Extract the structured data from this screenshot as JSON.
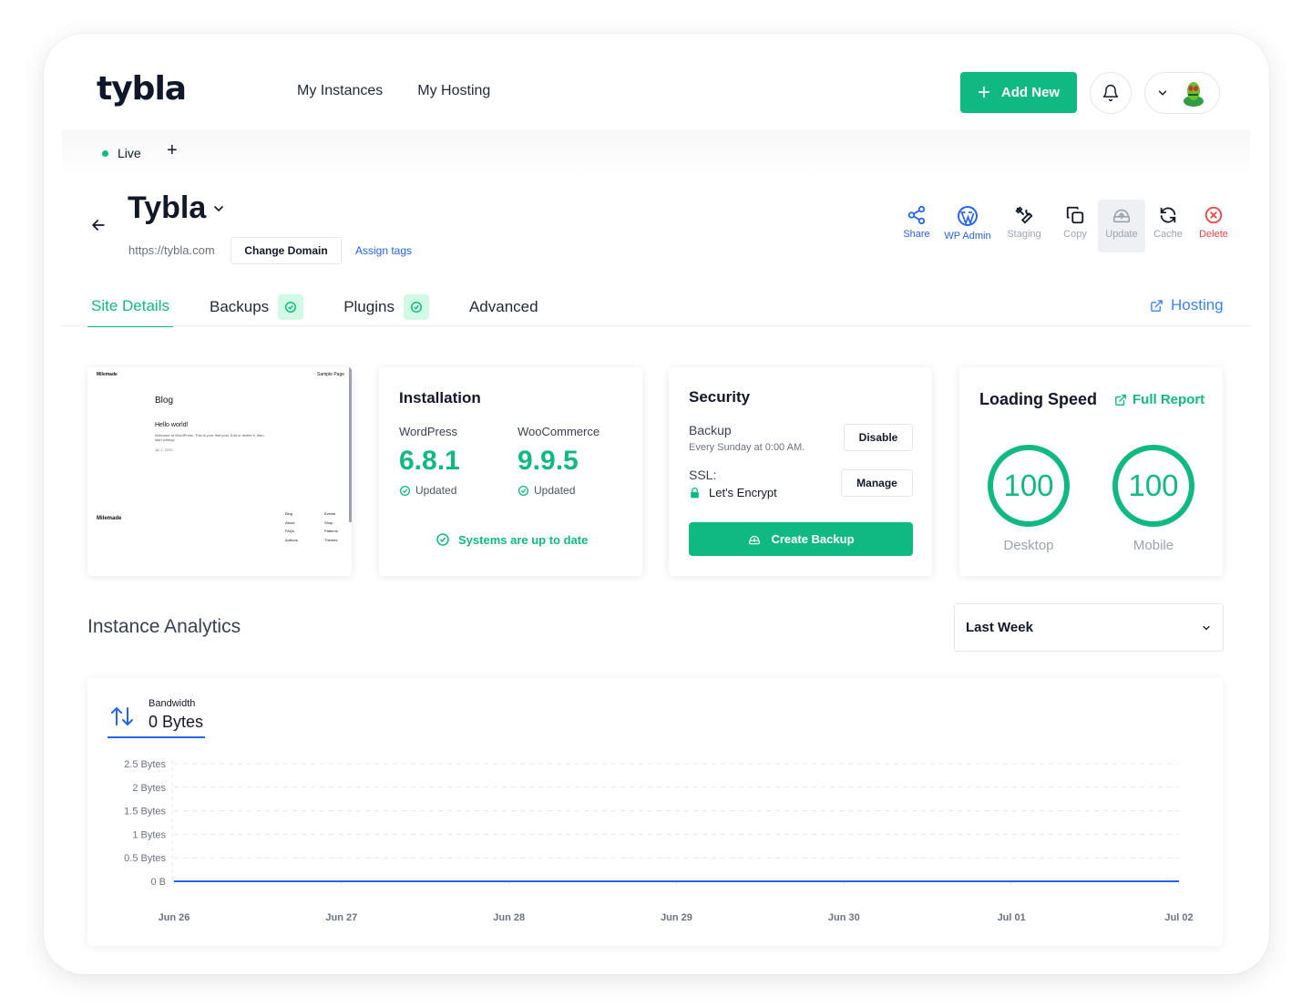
{
  "brand": {
    "logo": "tybla",
    "accent": "#10b981",
    "link": "#2563eb",
    "danger": "#ef4444"
  },
  "nav": {
    "items": [
      "My Instances",
      "My Hosting"
    ]
  },
  "header": {
    "add_new": "Add New"
  },
  "environment": {
    "live": "Live",
    "add": "+"
  },
  "site": {
    "title": "Tybla",
    "url": "https://tybla.com",
    "change_domain": "Change Domain",
    "assign_tags": "Assign tags"
  },
  "actions": [
    {
      "label": "Share",
      "icon": "share-icon"
    },
    {
      "label": "WP Admin",
      "icon": "wordpress-icon"
    },
    {
      "label": "Staging",
      "icon": "tools-icon"
    },
    {
      "label": "Copy",
      "icon": "copy-icon"
    },
    {
      "label": "Update",
      "icon": "update-icon"
    },
    {
      "label": "Cache",
      "icon": "refresh-icon"
    },
    {
      "label": "Delete",
      "icon": "delete-icon"
    }
  ],
  "tabs": [
    {
      "label": "Site Details",
      "active": true
    },
    {
      "label": "Backups",
      "badge": "check"
    },
    {
      "label": "Plugins",
      "badge": "check"
    },
    {
      "label": "Advanced"
    }
  ],
  "hosting_link": "Hosting",
  "preview": {
    "site_name": "Milemade",
    "menu": "Sample Page",
    "heading": "Blog",
    "post_title": "Hello world!",
    "post_excerpt": "Welcome to WordPress. This is your first post. Edit or delete it, then start writing!",
    "post_date": "Jul 2, 2025",
    "footer_name": "Milemade",
    "footer_col1": [
      "Blog",
      "About",
      "FAQs",
      "Authors"
    ],
    "footer_col2": [
      "Events",
      "Shop",
      "Patterns",
      "Themes"
    ]
  },
  "installation": {
    "title": "Installation",
    "items": [
      {
        "name": "WordPress",
        "version": "6.8.1",
        "status": "Updated"
      },
      {
        "name": "WooCommerce",
        "version": "9.9.5",
        "status": "Updated"
      }
    ],
    "summary": "Systems are up to date"
  },
  "security": {
    "title": "Security",
    "backup_label": "Backup",
    "backup_schedule": "Every Sunday at 0:00 AM.",
    "disable": "Disable",
    "ssl_label": "SSL:",
    "ssl_provider": "Let's Encrypt",
    "manage": "Manage",
    "create_backup": "Create Backup"
  },
  "speed": {
    "title": "Loading Speed",
    "full_report": "Full Report",
    "desktop_score": "100",
    "desktop_label": "Desktop",
    "mobile_score": "100",
    "mobile_label": "Mobile"
  },
  "analytics": {
    "title": "Instance Analytics",
    "period": "Last Week",
    "metric_label": "Bandwidth",
    "metric_value": "0 Bytes"
  },
  "chart_data": {
    "type": "line",
    "x": [
      "Jun 26",
      "Jun 27",
      "Jun 28",
      "Jun 29",
      "Jun 30",
      "Jul 01",
      "Jul 02"
    ],
    "series": [
      {
        "name": "Bandwidth",
        "values": [
          0,
          0,
          0,
          0,
          0,
          0,
          0
        ]
      }
    ],
    "y_ticks": [
      "2.5 Bytes",
      "2 Bytes",
      "1.5 Bytes",
      "1 Bytes",
      "0.5 Bytes",
      "0 B"
    ],
    "ylim": [
      0,
      2.5
    ],
    "grid": true,
    "color": "#2563eb"
  }
}
